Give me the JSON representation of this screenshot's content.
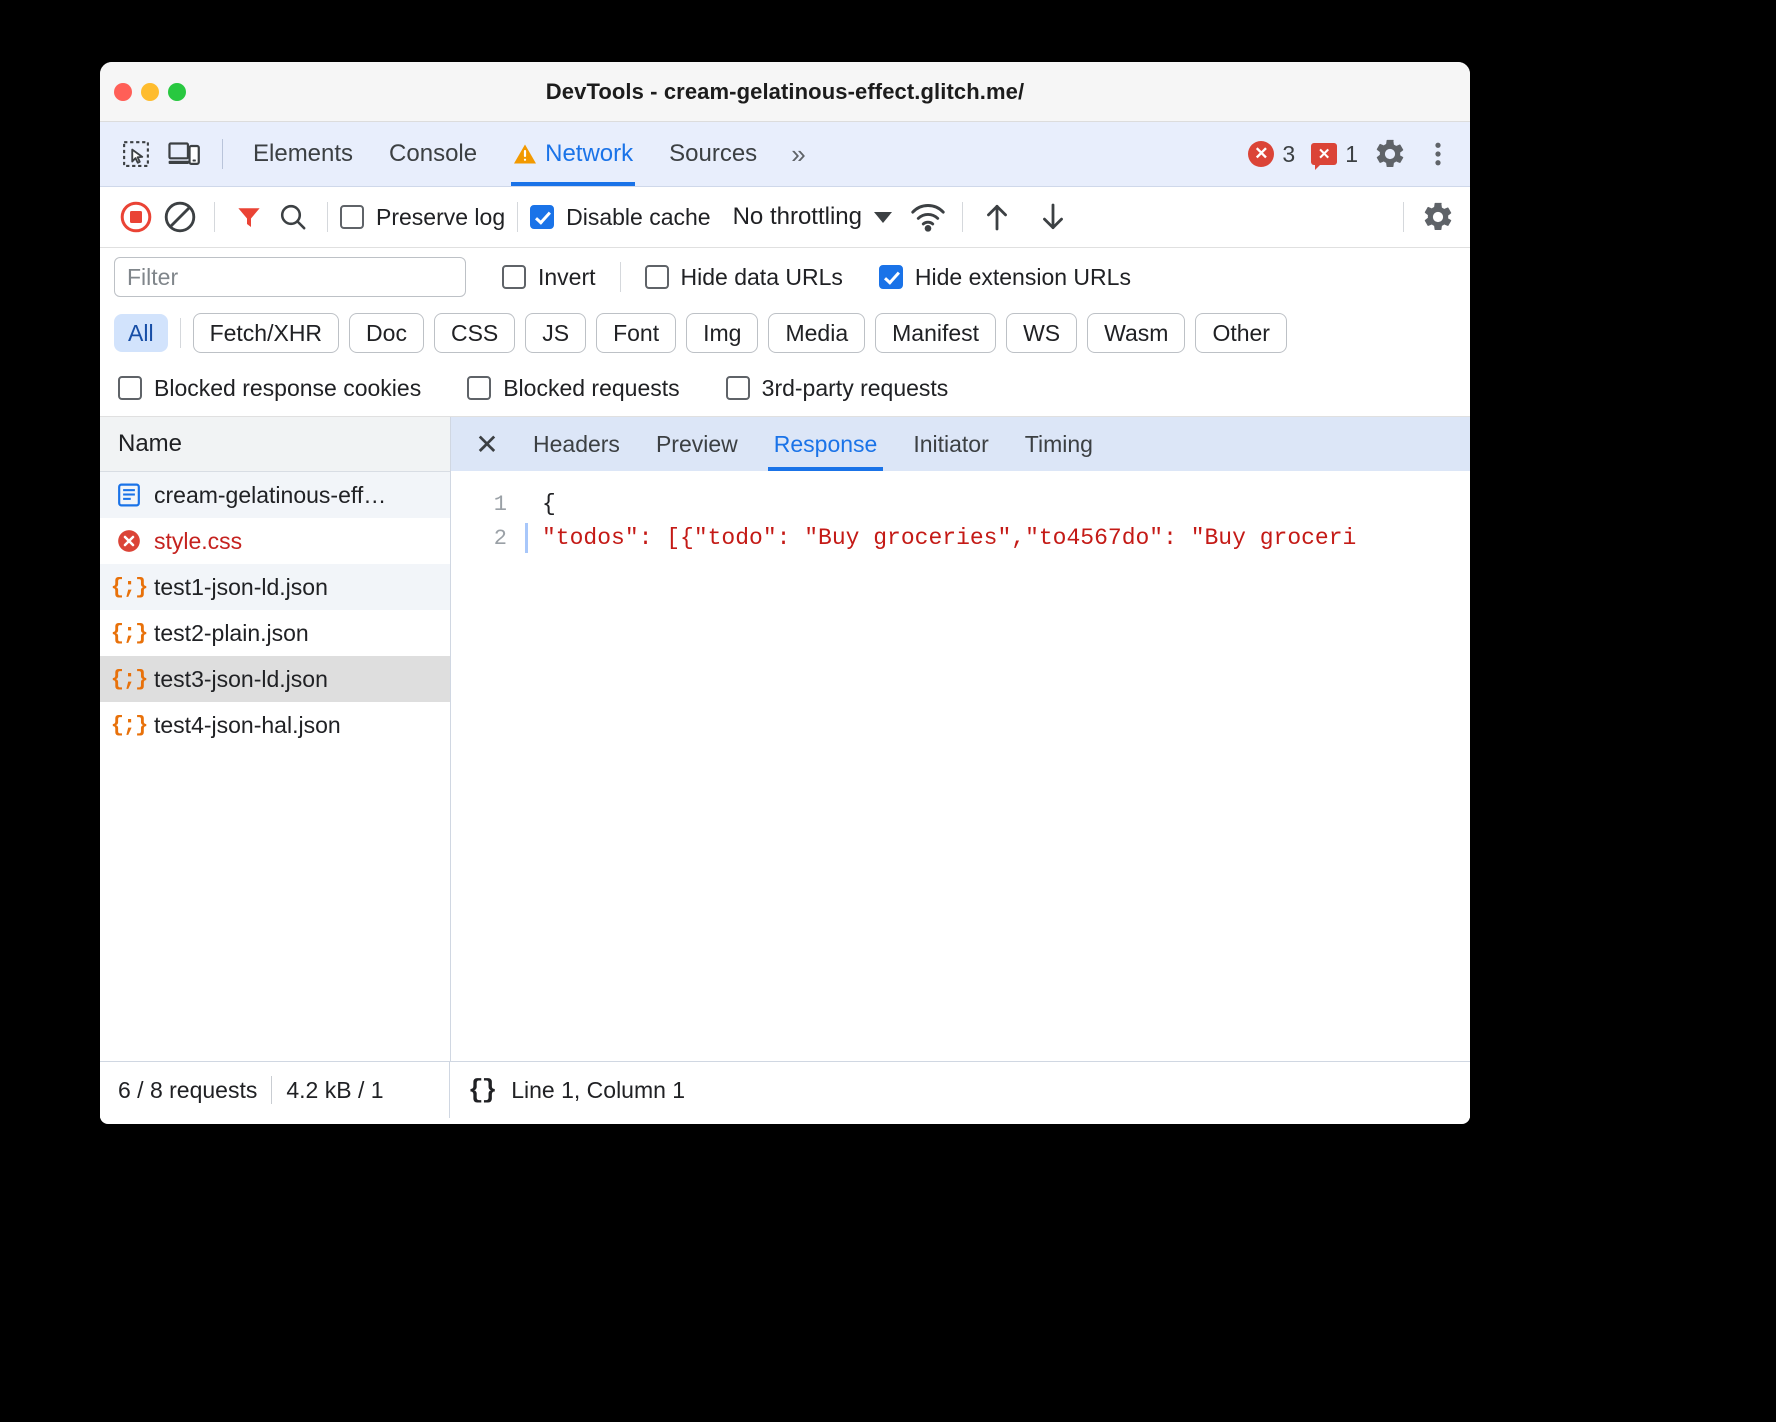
{
  "window": {
    "title": "DevTools - cream-gelatinous-effect.glitch.me/",
    "traffic_lights": [
      "close",
      "minimize",
      "zoom"
    ]
  },
  "main_tabs": {
    "left_icons": [
      "inspect-element-icon",
      "device-toolbar-icon"
    ],
    "items": [
      {
        "label": "Elements",
        "active": false,
        "warning": false
      },
      {
        "label": "Console",
        "active": false,
        "warning": false
      },
      {
        "label": "Network",
        "active": true,
        "warning": true
      },
      {
        "label": "Sources",
        "active": false,
        "warning": false
      }
    ],
    "more_label": "»",
    "error_count": "3",
    "warning_count": "1",
    "settings_icon": "gear-icon",
    "menu_icon": "kebab-menu-icon"
  },
  "network_toolbar": {
    "record_icon": "record-stop-icon",
    "clear_icon": "clear-icon",
    "filter_icon": "filter-funnel-icon",
    "search_icon": "search-icon",
    "preserve_log": {
      "label": "Preserve log",
      "checked": false
    },
    "disable_cache": {
      "label": "Disable cache",
      "checked": true
    },
    "throttling": {
      "value": "No throttling"
    },
    "wifi_icon": "network-conditions-icon",
    "import_icon": "import-har-icon",
    "export_icon": "export-har-icon",
    "settings_icon": "network-settings-gear-icon"
  },
  "filter_bar": {
    "input_placeholder": "Filter",
    "input_value": "",
    "invert": {
      "label": "Invert",
      "checked": false
    },
    "hide_data_urls": {
      "label": "Hide data URLs",
      "checked": false
    },
    "hide_extension_urls": {
      "label": "Hide extension URLs",
      "checked": true
    }
  },
  "type_chips": [
    {
      "label": "All",
      "active": true
    },
    {
      "label": "Fetch/XHR",
      "active": false
    },
    {
      "label": "Doc",
      "active": false
    },
    {
      "label": "CSS",
      "active": false
    },
    {
      "label": "JS",
      "active": false
    },
    {
      "label": "Font",
      "active": false
    },
    {
      "label": "Img",
      "active": false
    },
    {
      "label": "Media",
      "active": false
    },
    {
      "label": "Manifest",
      "active": false
    },
    {
      "label": "WS",
      "active": false
    },
    {
      "label": "Wasm",
      "active": false
    },
    {
      "label": "Other",
      "active": false
    }
  ],
  "blocked_filters": [
    {
      "label": "Blocked response cookies",
      "checked": false
    },
    {
      "label": "Blocked requests",
      "checked": false
    },
    {
      "label": "3rd-party requests",
      "checked": false
    }
  ],
  "request_list": {
    "column_header": "Name",
    "rows": [
      {
        "name": "cream-gelatinous-eff…",
        "icon": "document-icon",
        "state": "alt",
        "error": false
      },
      {
        "name": "style.css",
        "icon": "error-circle-icon",
        "state": "normal",
        "error": true
      },
      {
        "name": "test1-json-ld.json",
        "icon": "json-braces-icon",
        "state": "alt",
        "error": false
      },
      {
        "name": "test2-plain.json",
        "icon": "json-braces-icon",
        "state": "normal",
        "error": false
      },
      {
        "name": "test3-json-ld.json",
        "icon": "json-braces-icon",
        "state": "selected",
        "error": false
      },
      {
        "name": "test4-json-hal.json",
        "icon": "json-braces-icon",
        "state": "normal",
        "error": false
      }
    ]
  },
  "detail_panel": {
    "close_icon": "close-icon",
    "tabs": [
      {
        "label": "Headers",
        "active": false
      },
      {
        "label": "Preview",
        "active": false
      },
      {
        "label": "Response",
        "active": true
      },
      {
        "label": "Initiator",
        "active": false
      },
      {
        "label": "Timing",
        "active": false
      }
    ],
    "code": {
      "lines": [
        {
          "number": "1",
          "fold": false,
          "text": "{"
        },
        {
          "number": "2",
          "fold": true,
          "text": "  \"todos\": [{\"todo\": \"Buy groceries\",\"to4567do\": \"Buy groceri"
        }
      ]
    }
  },
  "status_bar": {
    "requests": "6 / 8 requests",
    "transferred": "4.2 kB / 1",
    "pretty_print_icon": "{}",
    "cursor_position": "Line 1, Column 1"
  },
  "colors": {
    "accent": "#1a73e8",
    "error": "#db4437",
    "json_icon": "#e8710a",
    "selected_row": "#dedede",
    "tabstrip_bg": "#e8eefc",
    "detail_tabs_bg": "#dce6f7",
    "string_literal": "#c41a16"
  }
}
